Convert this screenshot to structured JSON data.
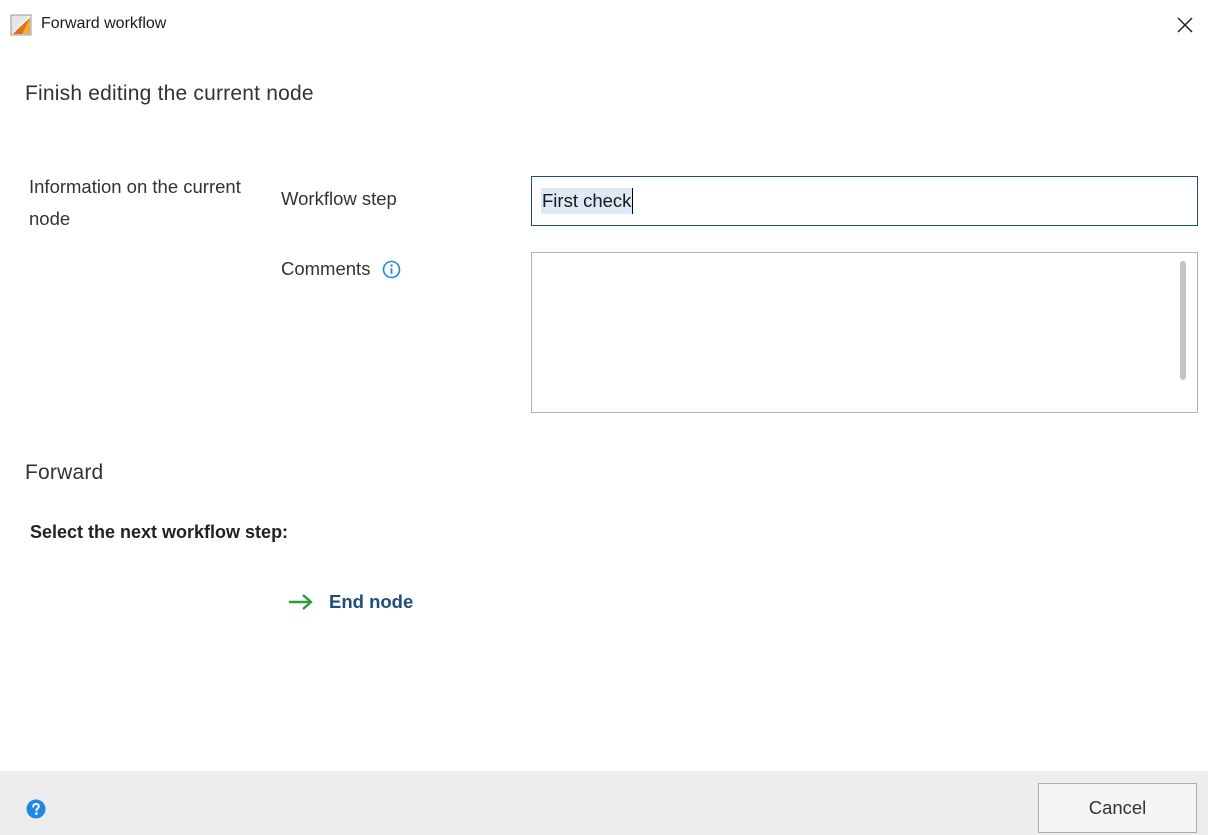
{
  "window": {
    "title": "Forward workflow"
  },
  "finish_section": {
    "heading": "Finish editing the current node",
    "info_label": "Information on the current node",
    "workflow_step_label": "Workflow step",
    "workflow_step_value": "First check",
    "comments_label": "Comments",
    "comments_value": ""
  },
  "forward_section": {
    "heading": "Forward",
    "select_label": "Select the next workflow step:",
    "options": [
      {
        "label": "End node",
        "icon": "arrow-right-icon"
      }
    ]
  },
  "footer": {
    "cancel_label": "Cancel",
    "help_icon": "question-circle-icon"
  },
  "colors": {
    "accent": "#1f4e79",
    "info_icon": "#1e88e5",
    "arrow": "#2e9a3a",
    "footer_bg": "#ededed",
    "help_icon": "#1e88e5"
  }
}
